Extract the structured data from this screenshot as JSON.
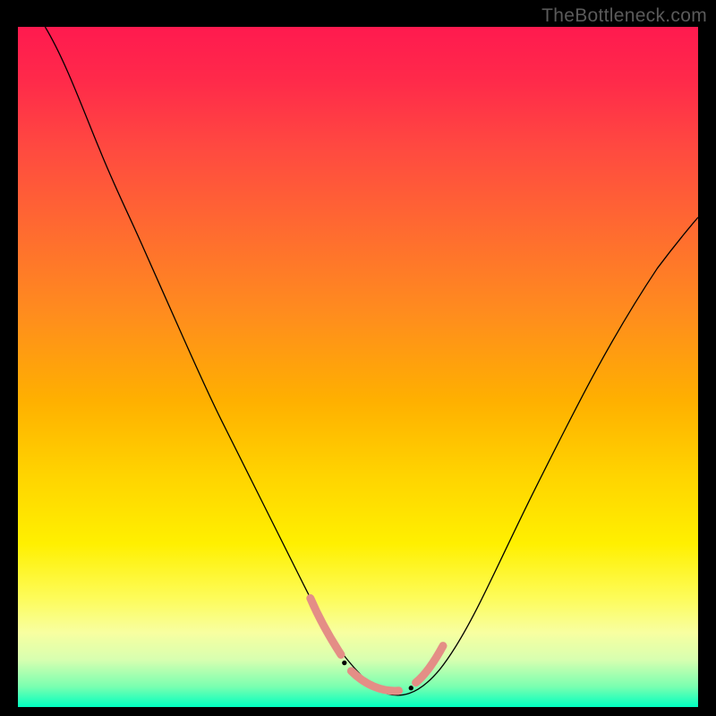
{
  "watermark": "TheBottleneck.com",
  "chart_data": {
    "type": "line",
    "title": "",
    "xlabel": "",
    "ylabel": "",
    "xlim": [
      0,
      100
    ],
    "ylim": [
      0,
      100
    ],
    "grid": false,
    "series": [
      {
        "name": "curve",
        "color": "#000000",
        "x": [
          4,
          8,
          12,
          16,
          20,
          24,
          28,
          32,
          36,
          40,
          43,
          46,
          49,
          52,
          55,
          58,
          61,
          64,
          68,
          72,
          76,
          80,
          85,
          90,
          95,
          100
        ],
        "y": [
          100,
          91,
          82,
          73,
          64,
          55,
          46,
          38,
          30,
          22,
          16,
          11,
          7,
          4,
          2,
          1.5,
          2,
          4,
          9,
          16,
          24,
          32,
          41,
          50,
          59,
          68
        ]
      }
    ],
    "annotation_band": {
      "description": "Dashed pink band at curve minimum",
      "color": "#e48e86",
      "y_level": 3,
      "x_range": [
        43,
        62
      ]
    },
    "gradient_stops": [
      {
        "pct": 0,
        "hex": "#ff1a4f"
      },
      {
        "pct": 8,
        "hex": "#ff2a4a"
      },
      {
        "pct": 18,
        "hex": "#ff4a40"
      },
      {
        "pct": 30,
        "hex": "#ff6b30"
      },
      {
        "pct": 42,
        "hex": "#ff8c1e"
      },
      {
        "pct": 55,
        "hex": "#ffb000"
      },
      {
        "pct": 66,
        "hex": "#ffd400"
      },
      {
        "pct": 76,
        "hex": "#fff000"
      },
      {
        "pct": 84,
        "hex": "#fdfc5a"
      },
      {
        "pct": 89,
        "hex": "#f8ffa0"
      },
      {
        "pct": 93,
        "hex": "#d8ffb0"
      },
      {
        "pct": 97,
        "hex": "#7affb0"
      },
      {
        "pct": 100,
        "hex": "#00ffc0"
      }
    ]
  }
}
